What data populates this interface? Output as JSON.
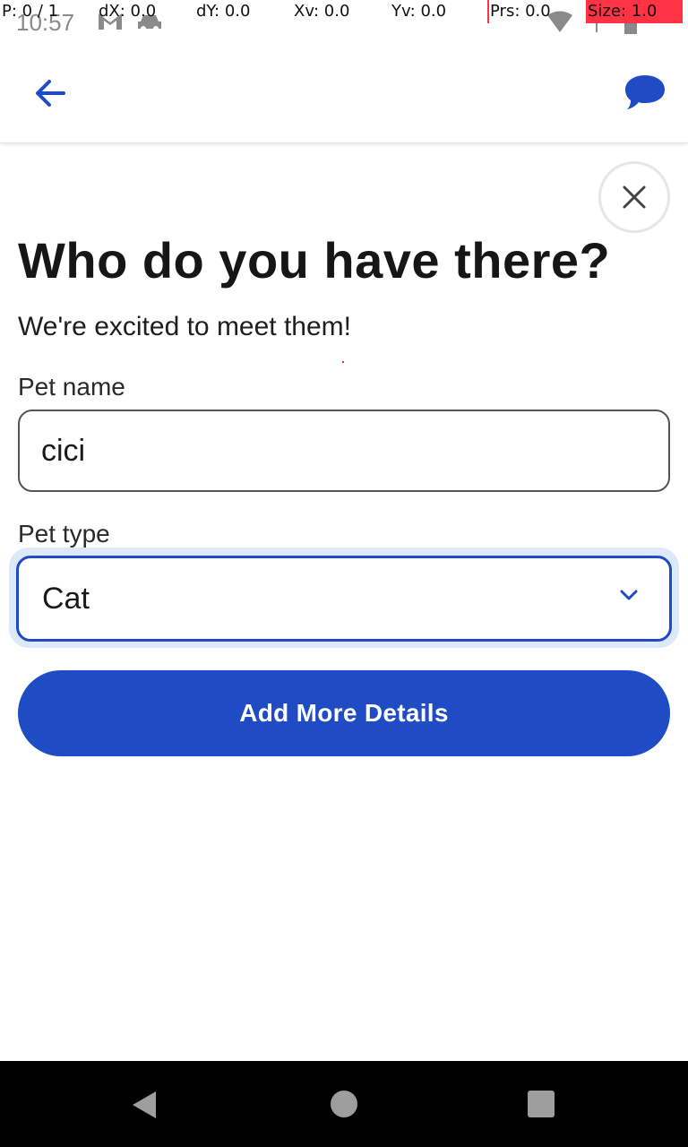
{
  "status_bar": {
    "time": "10:57",
    "overlay": {
      "p": "P: 0 / 1",
      "dx": "dX: 0.0",
      "dy": "dY: 0.0",
      "xv": "Xv: 0.0",
      "yv": "Yv: 0.0",
      "prs": "Prs: 0.0",
      "size": "Size: 1.0"
    }
  },
  "header": {
    "back_icon": "arrow-left-icon",
    "chat_icon": "chat-bubble-icon"
  },
  "dialog": {
    "close_icon": "close-icon",
    "title": "Who do you have there?",
    "subtitle": "We're excited to meet them!",
    "pet_name_label": "Pet name",
    "pet_name_value": "cici",
    "pet_type_label": "Pet type",
    "pet_type_value": "Cat",
    "primary_button": "Add More Details"
  },
  "colors": {
    "accent": "#1f4bc4",
    "focus_ring": "#dde8f8"
  }
}
